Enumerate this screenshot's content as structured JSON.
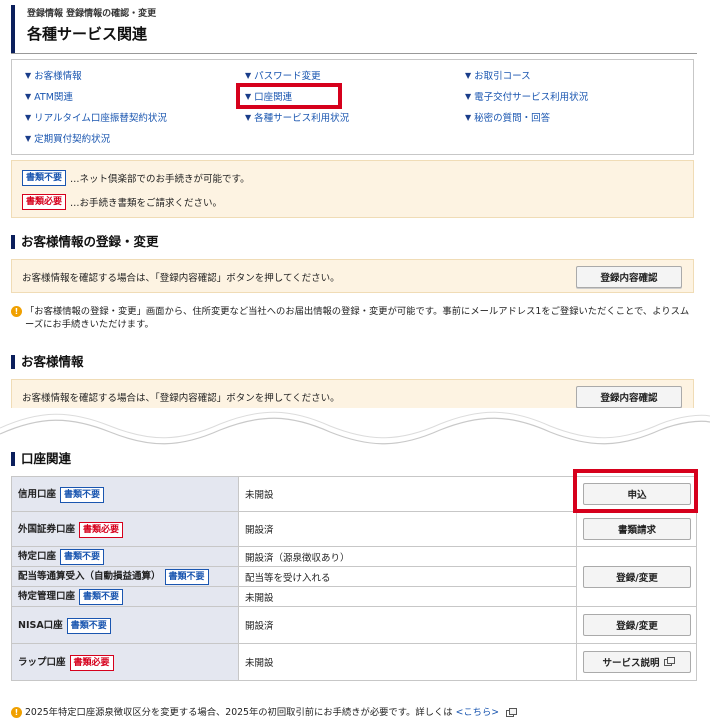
{
  "header": {
    "breadcrumb": "登録情報 登録情報の確認・変更",
    "title": "各種サービス関連"
  },
  "nav": {
    "items": [
      {
        "label": "お客様情報"
      },
      {
        "label": "パスワード変更"
      },
      {
        "label": "お取引コース"
      },
      {
        "label": "ATM関連"
      },
      {
        "label": "口座関連"
      },
      {
        "label": "電子交付サービス利用状況"
      },
      {
        "label": "リアルタイム口座振替契約状況"
      },
      {
        "label": "各種サービス利用状況"
      },
      {
        "label": "秘密の質問・回答"
      },
      {
        "label": "定期買付契約状況"
      }
    ]
  },
  "legend": {
    "no_doc_tag": "書類不要",
    "no_doc_text": "…ネット倶楽部でのお手続きが可能です。",
    "doc_tag": "書類必要",
    "doc_text": "…お手続き書類をご請求ください。"
  },
  "section_register": {
    "heading": "お客様情報の登録・変更",
    "message": "お客様情報を確認する場合は、「登録内容確認」ボタンを押してください。",
    "button": "登録内容確認",
    "note": "「お客様情報の登録・変更」画面から、住所変更など当社へのお届出情報の登録・変更が可能です。事前にメールアドレス1をご登録いただくことで、よりスムーズにお手続きいただけます。"
  },
  "section_info": {
    "heading": "お客様情報",
    "message": "お客様情報を確認する場合は、「登録内容確認」ボタンを押してください。",
    "button": "登録内容確認"
  },
  "section_account": {
    "heading": "口座関連",
    "rows": [
      {
        "label": "信用口座",
        "tag": "書類不要",
        "status": "未開設",
        "action": "申込"
      },
      {
        "label": "外国証券口座",
        "tag": "書類必要",
        "status": "開設済",
        "action": "書類請求"
      },
      {
        "label": "特定口座",
        "tag": "書類不要",
        "status": "開設済（源泉徴収あり）",
        "action": "登録/変更"
      },
      {
        "label": "配当等通算受入（自動損益通算）",
        "tag": "書類不要",
        "status": "配当等を受け入れる"
      },
      {
        "label": "特定管理口座",
        "tag": "書類不要",
        "status": "未開設"
      },
      {
        "label": "NISA口座",
        "tag": "書類不要",
        "status": "開設済",
        "action": "登録/変更"
      },
      {
        "label": "ラップ口座",
        "tag": "書類必要",
        "status": "未開設",
        "action": "サービス説明"
      }
    ],
    "footer_note": "2025年特定口座源泉徴収区分を変更する場合、2025年の初回取引前にお手続きが必要です。詳しくは",
    "footer_link": "<こちら>"
  },
  "colors": {
    "accent_navy": "#0b1f5c",
    "link_blue": "#1a56b0",
    "highlight_red": "#d6001c",
    "notice_bg": "#fdf3e2",
    "label_bg": "#e4e7f0"
  }
}
